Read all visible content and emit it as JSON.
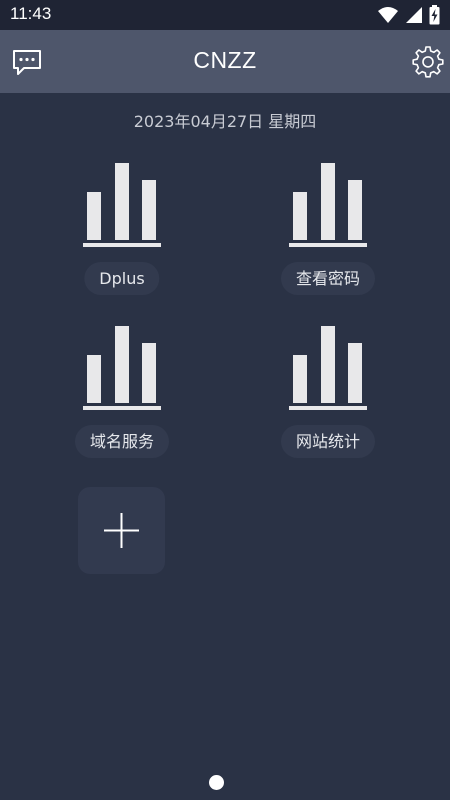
{
  "status_bar": {
    "time": "11:43",
    "icons": [
      "wifi-icon",
      "cellular-signal-icon",
      "battery-charging-icon"
    ]
  },
  "header": {
    "title": "CNZZ",
    "left_icon": "message-icon",
    "right_icon": "gear-icon"
  },
  "date": "2023年04月27日 星期四",
  "tiles": [
    {
      "label": "Dplus",
      "icon": "bar-chart-icon"
    },
    {
      "label": "查看密码",
      "icon": "bar-chart-icon"
    },
    {
      "label": "域名服务",
      "icon": "bar-chart-icon"
    },
    {
      "label": "网站统计",
      "icon": "bar-chart-icon"
    }
  ],
  "add_button": {
    "icon": "plus-icon"
  },
  "pager": {
    "pages": 1,
    "current": 1
  },
  "colors": {
    "background": "#2a3245",
    "header": "#4e566b",
    "status_bar": "#1f2434",
    "tile_label_bg": "#323a4e",
    "icon": "#e8e8ea"
  }
}
